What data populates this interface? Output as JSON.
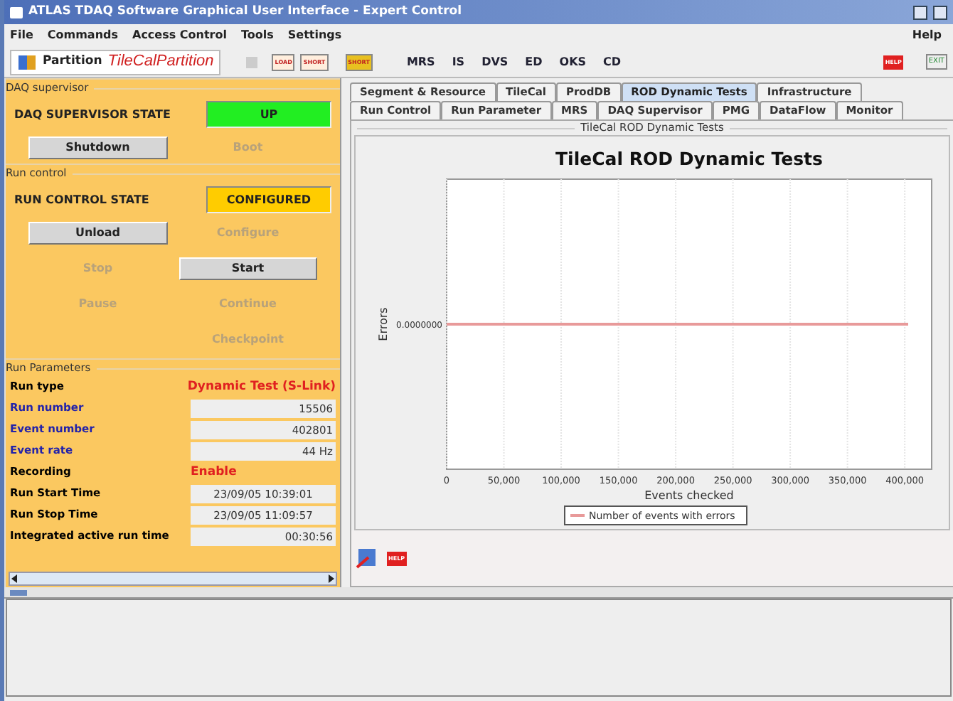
{
  "window": {
    "title": "ATLAS TDAQ Software Graphical User Interface - Expert Control"
  },
  "menu": [
    "File",
    "Commands",
    "Access Control",
    "Tools",
    "Settings"
  ],
  "menu_right": "Help",
  "toolbar": {
    "partition_label": "Partition",
    "partition_value": "TileCalPartition",
    "buttons": [
      {
        "label": "LOAD",
        "kind": "small"
      },
      {
        "label": "SHORT",
        "kind": "small"
      },
      {
        "label": "SHORT",
        "kind": "double"
      },
      {
        "label": "MRS",
        "kind": "text"
      },
      {
        "label": "IS",
        "kind": "text"
      },
      {
        "label": "DVS",
        "kind": "text"
      },
      {
        "label": "ED",
        "kind": "text"
      },
      {
        "label": "OKS",
        "kind": "text"
      },
      {
        "label": "CD",
        "kind": "text"
      }
    ],
    "right_buttons": [
      {
        "label": "HELP",
        "kind": "help"
      },
      {
        "label": "EXIT",
        "kind": "exit"
      }
    ]
  },
  "daq_supervisor": {
    "title": "DAQ supervisor",
    "state_label": "DAQ SUPERVISOR STATE",
    "state": "UP",
    "color": "#22ee22",
    "buttons": [
      {
        "label": "Shutdown",
        "disabled": false
      },
      {
        "label": "Boot",
        "disabled": true
      }
    ]
  },
  "run_control": {
    "title": "Run control",
    "state_label": "RUN CONTROL STATE",
    "state": "CONFIGURED",
    "color": "#ffcc00",
    "buttons": [
      {
        "label": "Unload",
        "disabled": false
      },
      {
        "label": "Configure",
        "disabled": true
      },
      {
        "label": "Stop",
        "disabled": true
      },
      {
        "label": "Start",
        "disabled": false
      },
      {
        "label": "Pause",
        "disabled": true
      },
      {
        "label": "Continue",
        "disabled": true
      },
      {
        "label": "Checkpoint",
        "disabled": true
      }
    ]
  },
  "run_parameters": {
    "title": "Run Parameters",
    "rows": [
      {
        "label": "Run type",
        "color": "#000000",
        "kind": "highlight",
        "value": "Dynamic Test (S-Link)"
      },
      {
        "label": "Run number",
        "color": "#2222aa",
        "kind": "field",
        "value": "15506"
      },
      {
        "label": "Event number",
        "color": "#2222aa",
        "kind": "field",
        "value": "402801"
      },
      {
        "label": "Event rate",
        "color": "#2222aa",
        "kind": "field",
        "value": "44 Hz"
      },
      {
        "label": "Recording",
        "color": "#000000",
        "kind": "highlight",
        "value": "Enable"
      },
      {
        "label": "Run Start Time",
        "color": "#000000",
        "kind": "center",
        "value": "23/09/05 10:39:01"
      },
      {
        "label": "Run Stop Time",
        "color": "#000000",
        "kind": "center",
        "value": "23/09/05 11:09:57"
      },
      {
        "label": "Integrated active run time",
        "color": "#000000",
        "kind": "field",
        "value": "00:30:56"
      }
    ]
  },
  "tabs_row1": [
    {
      "label": "Segment & Resource",
      "selected": false
    },
    {
      "label": "TileCal",
      "selected": false
    },
    {
      "label": "ProdDB",
      "selected": false
    },
    {
      "label": "ROD Dynamic Tests",
      "selected": true
    },
    {
      "label": "Infrastructure",
      "selected": false
    }
  ],
  "tabs_row2": [
    {
      "label": "Run Control",
      "selected": false
    },
    {
      "label": "Run Parameter",
      "selected": false
    },
    {
      "label": "MRS",
      "selected": false
    },
    {
      "label": "DAQ Supervisor",
      "selected": false
    },
    {
      "label": "PMG",
      "selected": false
    },
    {
      "label": "DataFlow",
      "selected": false
    },
    {
      "label": "Monitor",
      "selected": false
    }
  ],
  "panel": {
    "title": "TileCal ROD Dynamic Tests",
    "plot": {
      "title": "TileCal ROD Dynamic Tests",
      "xlabel": "Events checked",
      "ylabel": "Errors",
      "x_tick_labels": [
        "0",
        "50,000",
        "100,000",
        "150,000",
        "200,000",
        "250,000",
        "300,000",
        "350,000",
        "400,000"
      ],
      "y_tick_label": "0.0000000",
      "legend": "Number of events with errors"
    },
    "help_label": "HELP"
  }
}
